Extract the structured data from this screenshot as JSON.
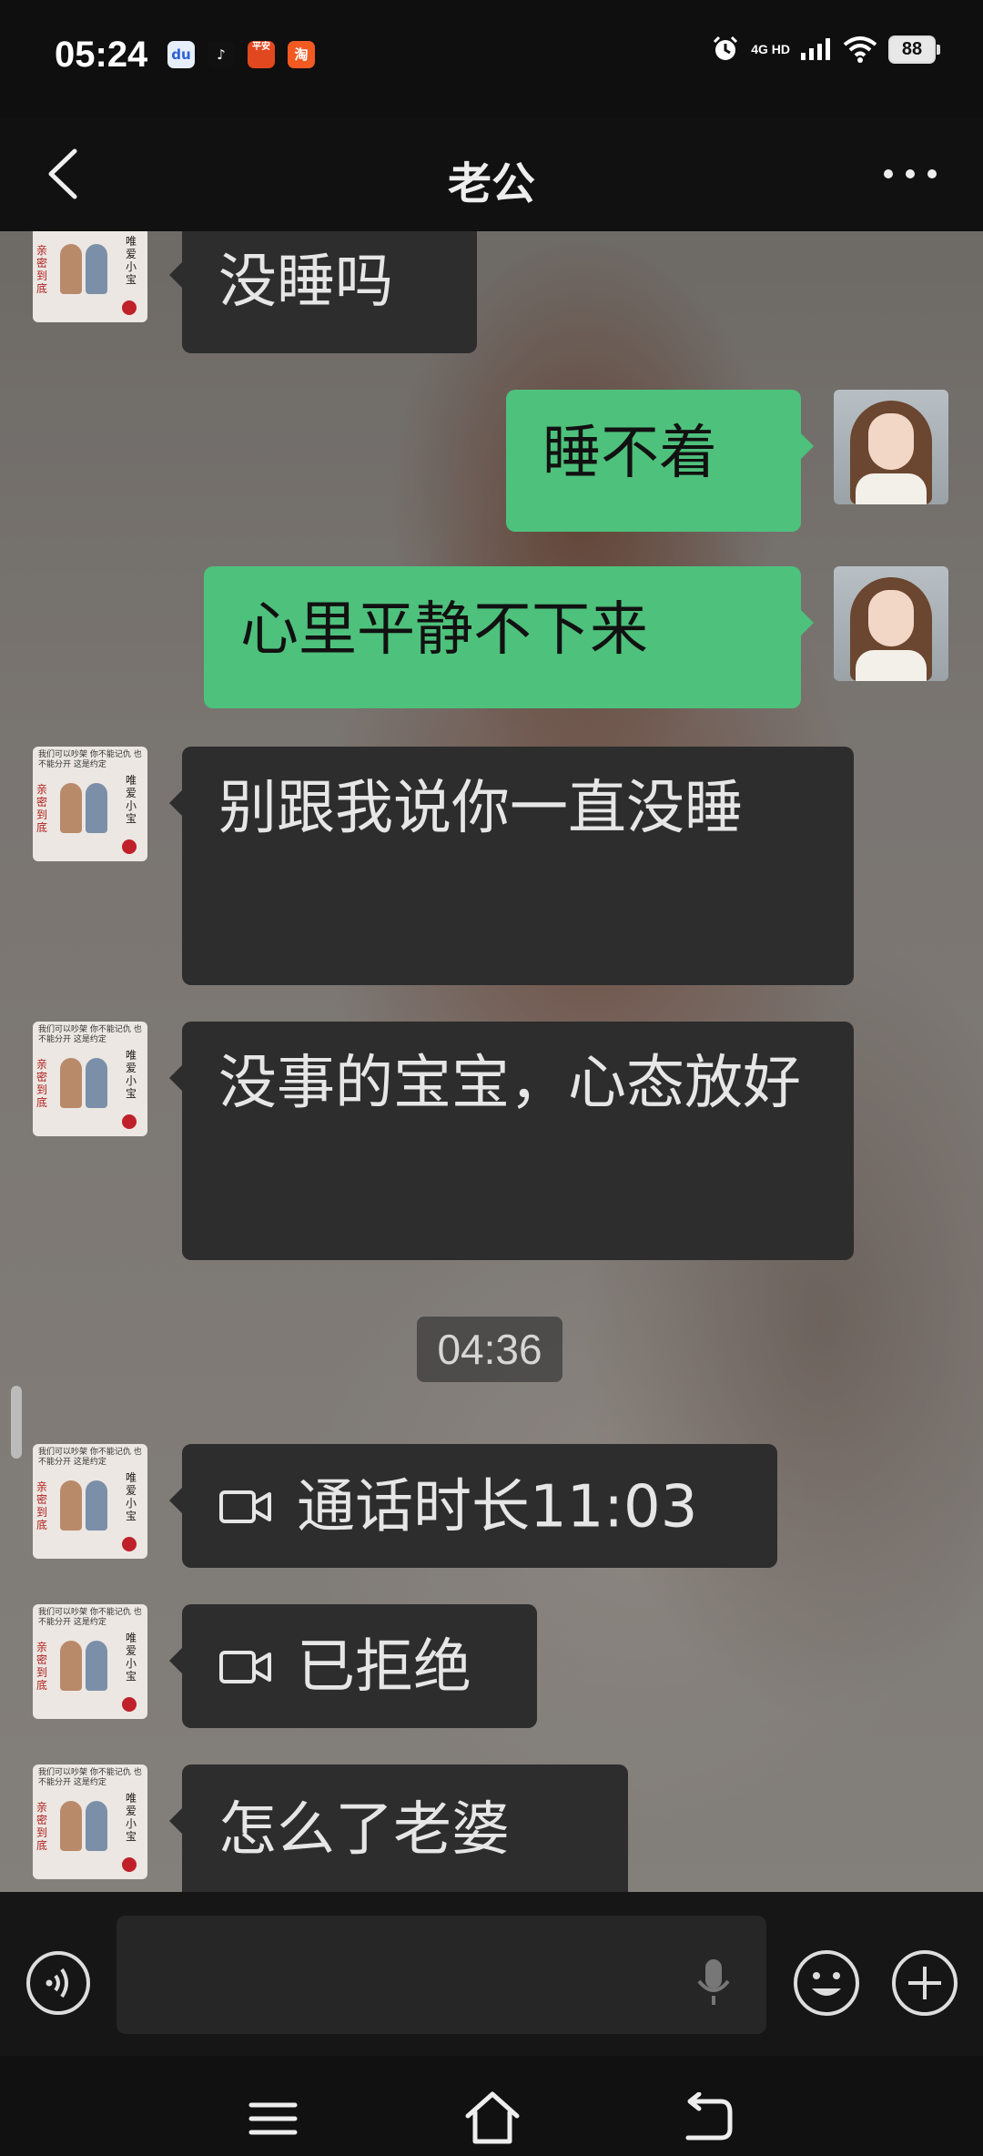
{
  "status_bar": {
    "time": "05:24",
    "network": "4G HD",
    "battery": "88",
    "apps": [
      "百度",
      "抖音",
      "平安银行",
      "淘宝"
    ]
  },
  "header": {
    "title": "老公"
  },
  "messages": [
    {
      "side": "left",
      "text": "没睡吗"
    },
    {
      "side": "right",
      "text": "睡不着"
    },
    {
      "side": "right",
      "text": "心里平静不下来"
    },
    {
      "side": "left",
      "text": "别跟我说你一直没睡"
    },
    {
      "side": "left",
      "text": "没事的宝宝，心态放好"
    },
    {
      "side": "left",
      "type": "call",
      "text": "通话时长11:03"
    },
    {
      "side": "left",
      "type": "call",
      "text": "已拒绝"
    },
    {
      "side": "left",
      "text": "怎么了老婆"
    }
  ],
  "timestamp": "04:36",
  "avatar_left_text": {
    "top": "我们可以吵架 你不能记仇 也不能分开 这是约定",
    "red": "亲密到底",
    "black": "唯爱小宝"
  },
  "input": {
    "placeholder": ""
  },
  "icons": {
    "back": "back-arrow-icon",
    "more": "more-dots-icon",
    "voice": "voice-input-icon",
    "mic": "microphone-icon",
    "emoji": "emoji-icon",
    "plus": "plus-icon",
    "video_call": "video-camera-icon"
  },
  "colors": {
    "bubble_right": "#4ec17c",
    "bubble_left": "#2d2d2d",
    "bar_bg": "#111111"
  }
}
